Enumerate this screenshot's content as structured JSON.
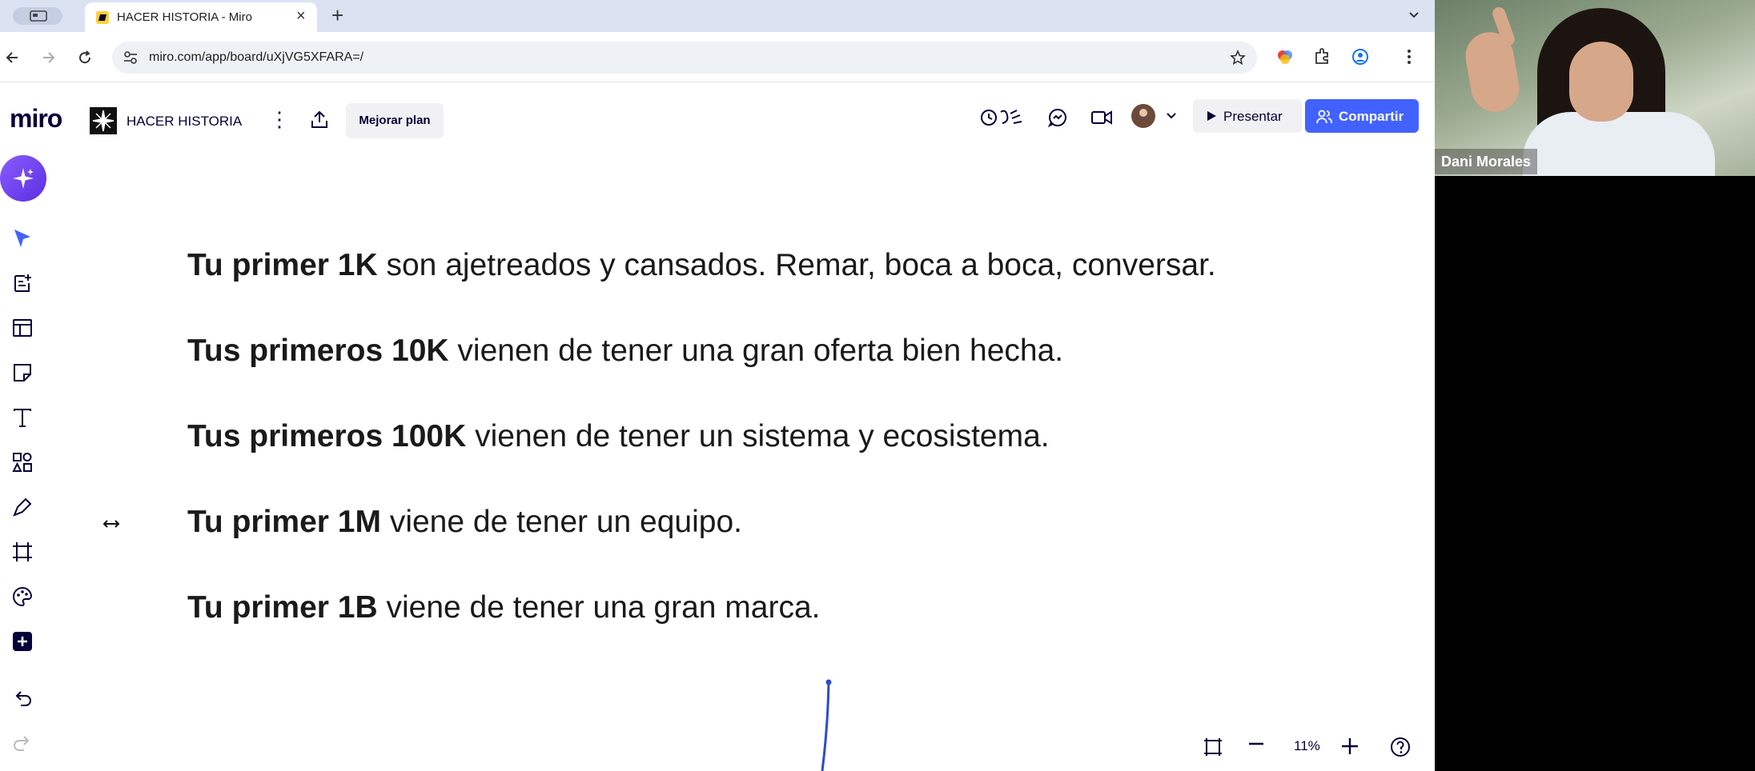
{
  "browser": {
    "tab_title": "HACER HISTORIA - Miro",
    "url": "miro.com/app/board/uXjVG5XFARA=/"
  },
  "miro": {
    "logo": "miro",
    "board_name": "HACER HISTORIA",
    "upgrade_label": "Mejorar plan",
    "present_label": "Presentar",
    "share_label": "Compartir",
    "zoom": "11%"
  },
  "board": {
    "lines": [
      {
        "bold": "Tu primer 1K",
        "rest": " son ajetreados y cansados. Remar, boca a boca, conversar."
      },
      {
        "bold": "Tus primeros 10K",
        "rest": " vienen de tener una gran oferta bien hecha."
      },
      {
        "bold": "Tus primeros 100K",
        "rest": " vienen de tener un sistema y ecosistema."
      },
      {
        "bold": "Tu primer 1M",
        "rest": " viene de tener un equipo."
      },
      {
        "bold": "Tu primer 1B",
        "rest": " viene de tener una gran marca."
      }
    ]
  },
  "video": {
    "participant_name": "Dani Morales"
  },
  "colors": {
    "accent": "#4262ff",
    "tabbar": "#dbe3f3",
    "miro_navy": "#050038"
  }
}
